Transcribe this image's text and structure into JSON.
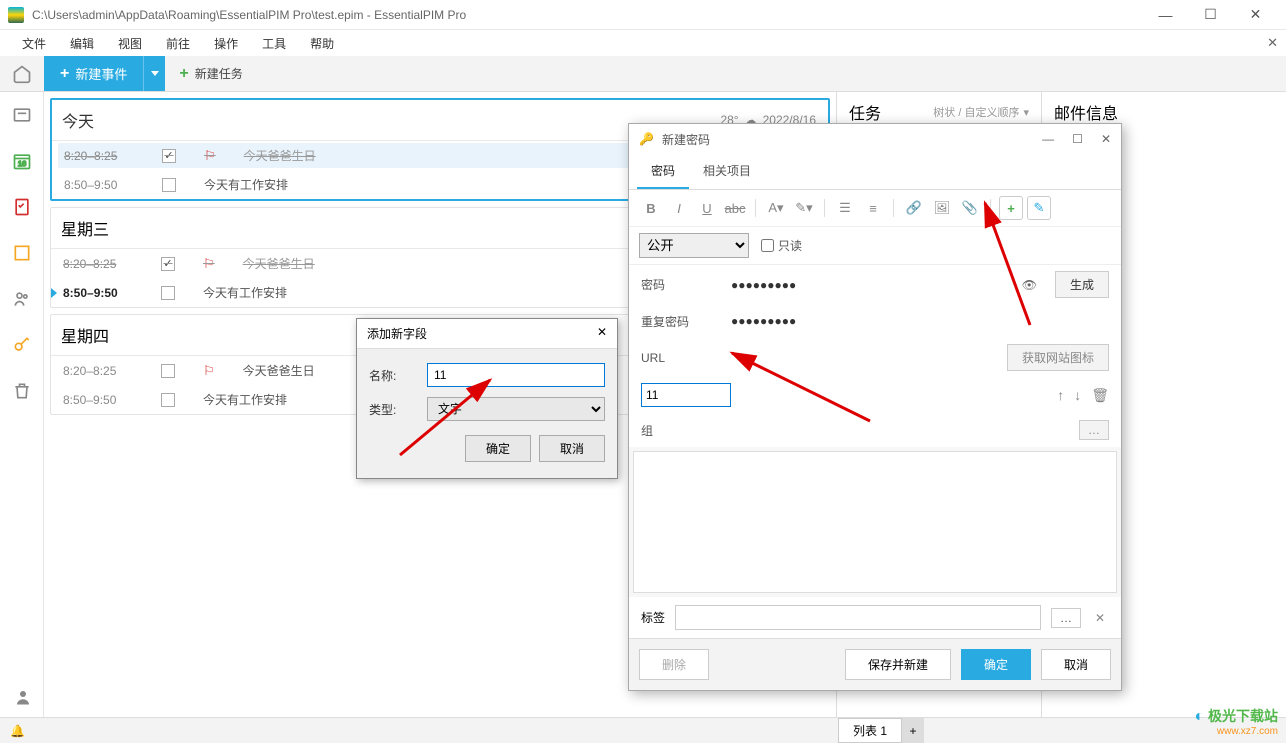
{
  "title": "C:\\Users\\admin\\AppData\\Roaming\\EssentialPIM Pro\\test.epim - EssentialPIM Pro",
  "menubar": [
    "文件",
    "编辑",
    "视图",
    "前往",
    "操作",
    "工具",
    "帮助"
  ],
  "toolbar": {
    "new_event": "新建事件",
    "new_task": "新建任务"
  },
  "today": {
    "header": "今天",
    "temp": "28°",
    "date": "2022/8/16",
    "events": [
      {
        "time": "8:20–8:25",
        "title": "今天爸爸生日",
        "done": true,
        "flag": true
      },
      {
        "time": "8:50–9:50",
        "title": "今天有工作安排",
        "done": false,
        "flag": false
      }
    ]
  },
  "wed": {
    "header": "星期三",
    "events": [
      {
        "time": "8:20–8:25",
        "title": "今天爸爸生日",
        "done": true,
        "flag": true
      },
      {
        "time": "8:50–9:50",
        "title": "今天有工作安排",
        "done": false,
        "flag": false
      }
    ]
  },
  "thu": {
    "header": "星期四",
    "events": [
      {
        "time": "8:20–8:25",
        "title": "今天爸爸生日",
        "done": false,
        "flag": true
      },
      {
        "time": "8:50–9:50",
        "title": "今天有工作安排",
        "done": false,
        "flag": false
      }
    ]
  },
  "task_panel": {
    "title": "任务",
    "sub": "树状 / 自定义顺序"
  },
  "mail_panel": {
    "title": "邮件信息"
  },
  "addfield": {
    "title": "添加新字段",
    "name_label": "名称:",
    "name_value": "11",
    "type_label": "类型:",
    "type_value": "文字",
    "ok": "确定",
    "cancel": "取消"
  },
  "newpw": {
    "title": "新建密码",
    "tab_pw": "密码",
    "tab_rel": "相关项目",
    "access": "公开",
    "readonly": "只读",
    "fld_pw": "密码",
    "fld_pw_val": "●●●●●●●●●",
    "btn_gen": "生成",
    "fld_rpw": "重复密码",
    "fld_rpw_val": "●●●●●●●●●",
    "fld_url": "URL",
    "btn_geticon": "获取网站图标",
    "fld_custom": "11",
    "fld_group": "组",
    "tag_label": "标签",
    "btn_del": "删除",
    "btn_save_new": "保存并新建",
    "btn_ok": "确定",
    "btn_cancel": "取消"
  },
  "statusbar": {
    "tab1": "列表 1"
  },
  "watermark": {
    "line1": "极光下载站",
    "line2": "www.xz7.com"
  }
}
